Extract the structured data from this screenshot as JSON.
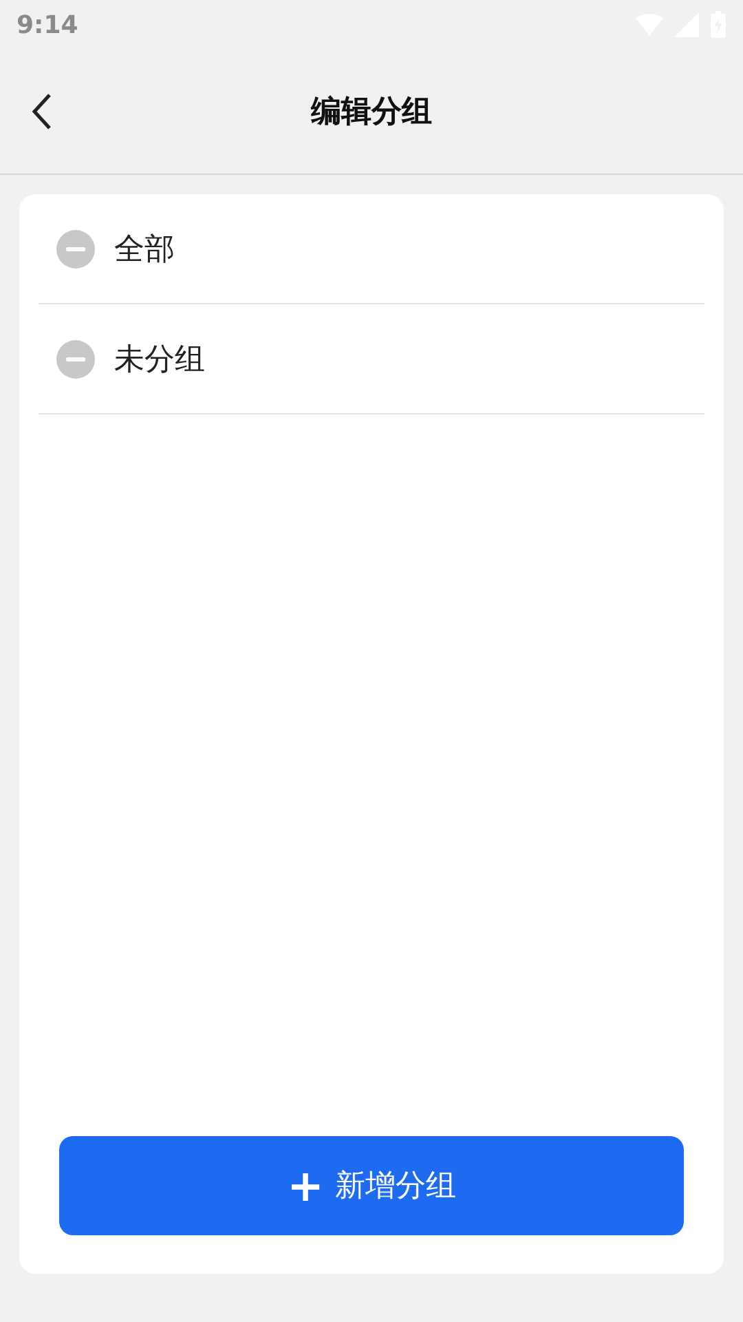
{
  "status_bar": {
    "time": "9:14"
  },
  "header": {
    "title": "编辑分组"
  },
  "groups": [
    {
      "name": "全部"
    },
    {
      "name": "未分组"
    }
  ],
  "add_button": {
    "icon": "+",
    "label": "新增分组"
  }
}
